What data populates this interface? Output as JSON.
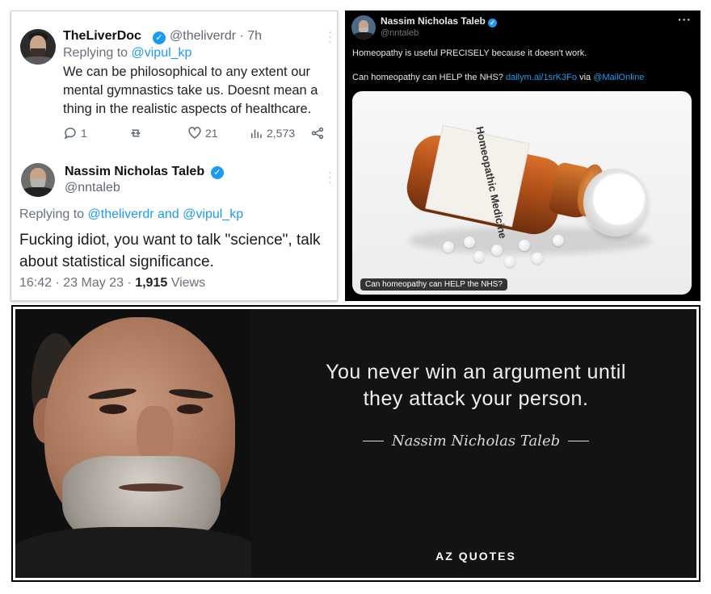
{
  "tweet1": {
    "author": "TheLiverDoc",
    "handle": "@theliverdr",
    "time": "· 7h",
    "replying_prefix": "Replying to",
    "replying_to": "@vipul_kp",
    "text": "We can be philosophical to any extent our mental gymnastics take us. Doesnt mean a thing in the realistic aspects of healthcare.",
    "replies": "1",
    "likes": "21",
    "views": "2,573"
  },
  "tweet2": {
    "author": "Nassim Nicholas Taleb",
    "handle": "@nntaleb",
    "replying_prefix": "Replying to",
    "replying_to_1": "@theliverdr",
    "replying_and": "and",
    "replying_to_2": "@vipul_kp",
    "text": "Fucking idiot, you want to talk \"science\", talk about statistical significance.",
    "timestamp": "16:42 · 23 May 23 ·",
    "views_count": "1,915",
    "views_label": "Views"
  },
  "tweet3": {
    "author": "Nassim Nicholas Taleb",
    "handle": "@nntaleb",
    "more": "···",
    "line1": "Homeopathy is useful PRECISELY because it doesn't work.",
    "line2_prefix": "Can homeopathy can HELP the NHS?",
    "link": "dailym.ai/1srK3Fo",
    "via": "via",
    "via_handle": "@MailOnline",
    "bottle_label": "Homeopathic Medicine",
    "card_caption": "Can homeopathy can HELP the NHS?"
  },
  "quote": {
    "line1": "You never win an argument until",
    "line2": "they attack your person.",
    "author": "Nassim Nicholas Taleb",
    "brand": "AZ QUOTES"
  },
  "colors": {
    "link_blue": "#1d9bf0",
    "dark_bg": "#000000",
    "quote_bg": "#131313"
  }
}
